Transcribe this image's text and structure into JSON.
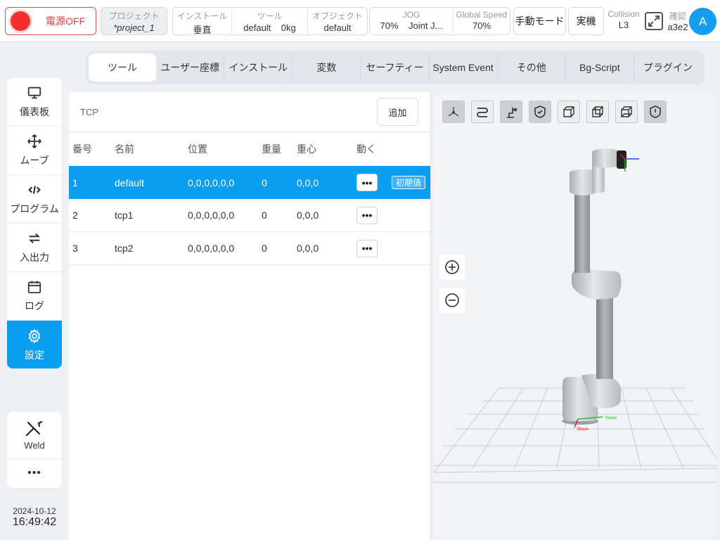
{
  "topbar": {
    "power_label": "電源OFF",
    "project": {
      "label": "プロジェクト",
      "value": "*project_1"
    },
    "install": {
      "label": "インストール",
      "value": "垂直"
    },
    "tool": {
      "label": "ツール",
      "value": "default",
      "weight": "0kg"
    },
    "object": {
      "label": "オブジェクト",
      "value": "default"
    },
    "jog": {
      "label": "JOG",
      "value": "70%",
      "mode": "Joint J..."
    },
    "global_speed": {
      "label": "Global Speed",
      "value": "70%"
    },
    "manual_mode": "手動モード",
    "real_machine": "実機",
    "collision": {
      "label": "Collision",
      "value": "L3"
    },
    "confirm": {
      "label": "確認",
      "value": "a3e2"
    },
    "avatar": "A"
  },
  "nav": {
    "items": [
      {
        "label": "儀表板",
        "icon": "monitor-icon"
      },
      {
        "label": "ムーブ",
        "icon": "move-arrows-icon"
      },
      {
        "label": "プログラム",
        "icon": "code-icon"
      },
      {
        "label": "入出力",
        "icon": "swap-arrows-icon"
      },
      {
        "label": "ログ",
        "icon": "calendar-icon"
      },
      {
        "label": "設定",
        "icon": "gear-icon",
        "active": true
      }
    ],
    "weld_label": "Weld",
    "more_label": "•••"
  },
  "clock": {
    "date": "2024-10-12",
    "time": "16:49:42"
  },
  "tabs": [
    "ツール",
    "ユーザー座標",
    "インストール",
    "変数",
    "セーフティー",
    "System Event",
    "その他",
    "Bg-Script",
    "プラグイン"
  ],
  "active_tab": "ツール",
  "panel": {
    "title": "TCP",
    "add_label": "追加",
    "columns": [
      "番号",
      "名前",
      "位置",
      "重量",
      "重心",
      "動く"
    ],
    "rows": [
      {
        "no": "1",
        "name": "default",
        "pos": "0,0,0,0,0,0",
        "weight": "0",
        "cog": "0,0,0",
        "badge": "初期值",
        "selected": true
      },
      {
        "no": "2",
        "name": "tcp1",
        "pos": "0,0,0,0,0,0",
        "weight": "0",
        "cog": "0,0,0"
      },
      {
        "no": "3",
        "name": "tcp2",
        "pos": "0,0,0,0,0,0",
        "weight": "0",
        "cog": "0,0,0"
      }
    ],
    "more_label": "•••"
  },
  "viewport": {
    "axis_x_label": "Xbase",
    "axis_y_label": "Ybase",
    "toolbar_icons": [
      "view-iso-icon",
      "path-icon",
      "robot-arm-icon",
      "shield-check-icon",
      "cube-front-icon",
      "cube-side-icon",
      "cube-top-icon",
      "shield-alert-icon"
    ]
  },
  "colors": {
    "accent": "#0a9df0",
    "power_red": "#e64a4a"
  }
}
